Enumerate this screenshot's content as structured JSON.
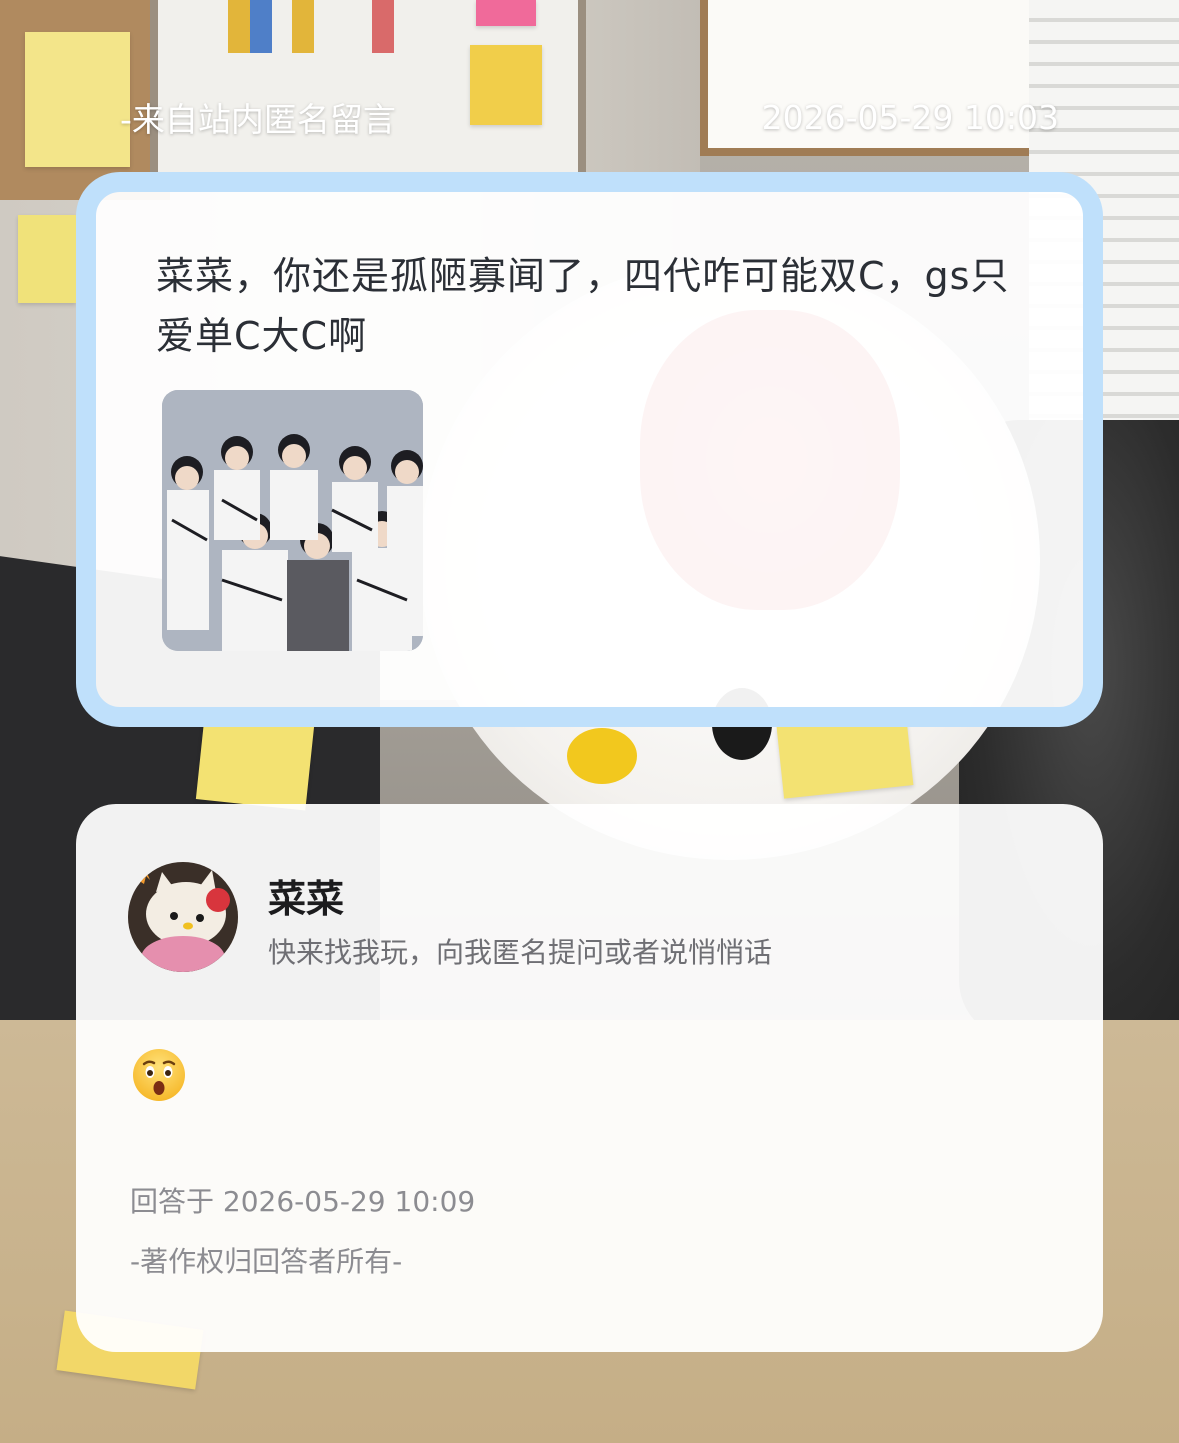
{
  "header": {
    "source_label": "-来自站内匿名留言",
    "timestamp": "2026-05-29 10:03"
  },
  "question": {
    "text": "菜菜，你还是孤陋寡闻了，四代咋可能双C，gs只爱单C大C啊",
    "image_icon": "group-photo"
  },
  "answer": {
    "name": "菜菜",
    "bio": "快来找我玩，向我匿名提问或者说悄悄话",
    "avatar_icon": "hello-kitty-avatar",
    "reply_emoji": "hushed-face-emoji",
    "answered_at": "回答于 2026-05-29 10:09",
    "copyright": "-著作权归回答者所有-"
  },
  "colors": {
    "question_border": "#bfe0fb",
    "card_bg": "#ffffff",
    "question_text": "#2b2f36",
    "meta_text": "#8c8c91"
  }
}
